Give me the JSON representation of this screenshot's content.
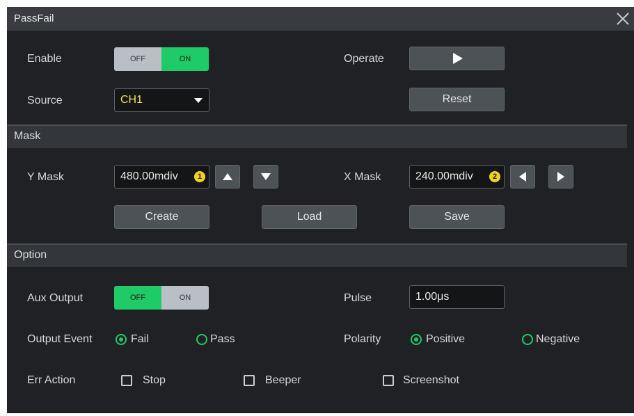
{
  "window": {
    "title": "PassFail"
  },
  "enable": {
    "label": "Enable",
    "off": "OFF",
    "on": "ON",
    "state": "ON"
  },
  "operate": {
    "label": "Operate"
  },
  "source": {
    "label": "Source",
    "value": "CH1"
  },
  "reset": {
    "label": "Reset"
  },
  "mask": {
    "section_label": "Mask",
    "y_label": "Y Mask",
    "y_value": "480.00mdiv",
    "y_badge": "1",
    "x_label": "X Mask",
    "x_value": "240.00mdiv",
    "x_badge": "2",
    "create": "Create",
    "load": "Load",
    "save": "Save"
  },
  "option": {
    "section_label": "Option",
    "aux_label": "Aux Output",
    "aux_off": "OFF",
    "aux_on": "ON",
    "aux_state": "OFF",
    "pulse_label": "Pulse",
    "pulse_value": "1.00μs",
    "output_event_label": "Output Event",
    "event_fail": "Fail",
    "event_pass": "Pass",
    "event_selected": "Fail",
    "polarity_label": "Polarity",
    "polarity_positive": "Positive",
    "polarity_negative": "Negative",
    "polarity_selected": "Positive",
    "err_label": "Err Action",
    "err_stop": "Stop",
    "err_beeper": "Beeper",
    "err_screenshot": "Screenshot"
  },
  "colors": {
    "accent_green": "#1fcb66",
    "badge_yellow": "#f2d31b",
    "source_text": "#f2e34a"
  }
}
